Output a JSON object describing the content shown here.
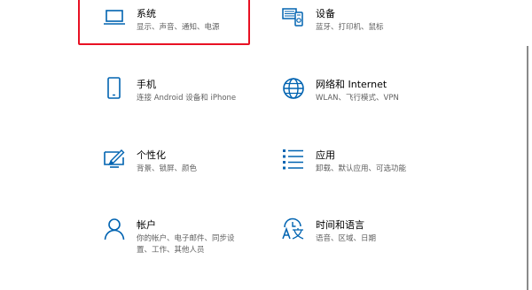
{
  "colors": {
    "accent": "#0063b1",
    "highlight_border": "#e81123",
    "secondary_text": "#5f5f5f"
  },
  "tiles": [
    {
      "title": "系统",
      "desc_line1": "显示、声音、通知、电源",
      "desc_line2": "",
      "icon": "monitor-icon"
    },
    {
      "title": "设备",
      "desc_line1": "蓝牙、打印机、鼠标",
      "desc_line2": "",
      "icon": "devices-icon"
    },
    {
      "title": "手机",
      "desc_line1": "连接 Android 设备和 iPhone",
      "desc_line2": "",
      "icon": "phone-icon"
    },
    {
      "title": "网络和 Internet",
      "desc_line1": "WLAN、飞行模式、VPN",
      "desc_line2": "",
      "icon": "globe-icon"
    },
    {
      "title": "个性化",
      "desc_line1": "背景、锁屏、颜色",
      "desc_line2": "",
      "icon": "personalization-icon"
    },
    {
      "title": "应用",
      "desc_line1": "卸载、默认应用、可选功能",
      "desc_line2": "",
      "icon": "apps-list-icon"
    },
    {
      "title": "帐户",
      "desc_line1": "你的帐户、电子邮件、同步设",
      "desc_line2": "置、工作、其他人员",
      "icon": "person-icon"
    },
    {
      "title": "时间和语言",
      "desc_line1": "语音、区域、日期",
      "desc_line2": "",
      "icon": "time-language-icon"
    }
  ]
}
